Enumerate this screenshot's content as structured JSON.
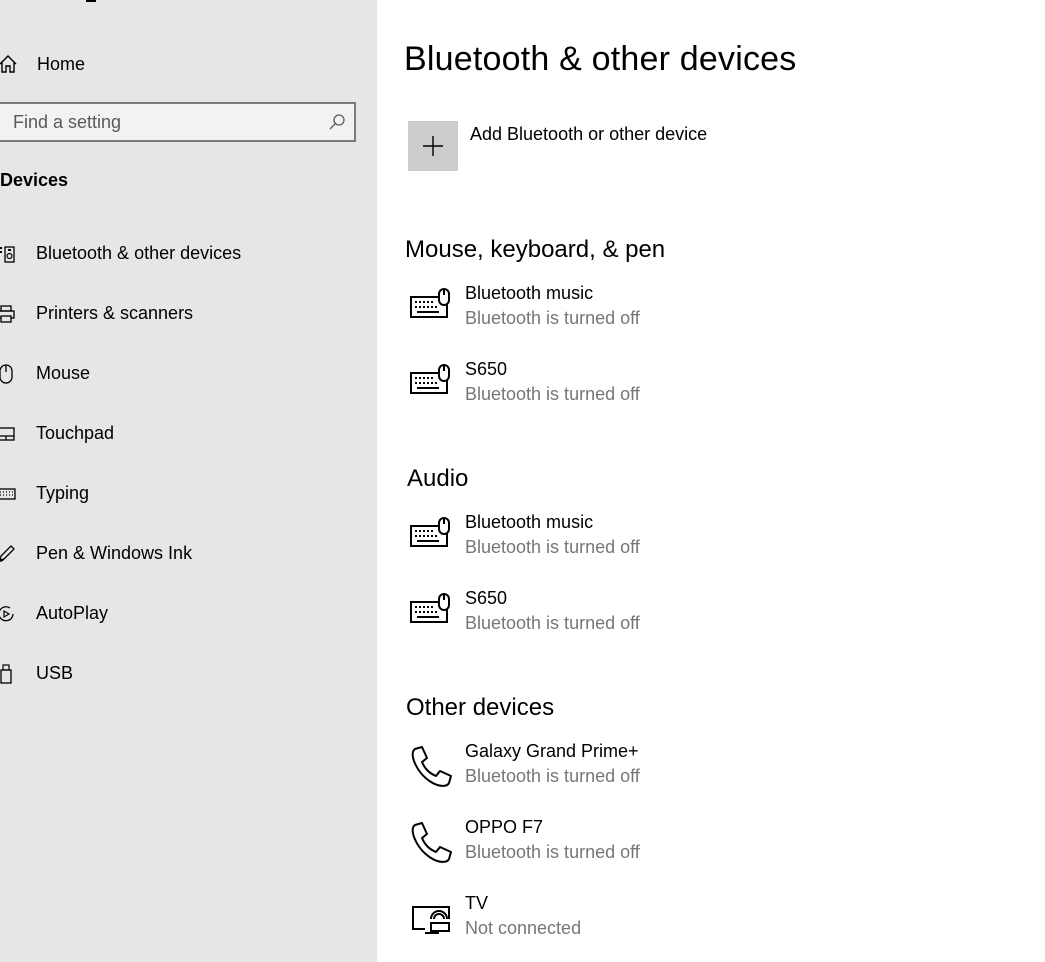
{
  "sidebar": {
    "home_label": "Home",
    "search_placeholder": "Find a setting",
    "section_title": "Devices",
    "items": [
      {
        "label": "Bluetooth & other devices",
        "icon": "bluetooth-devices-icon"
      },
      {
        "label": "Printers & scanners",
        "icon": "printer-icon"
      },
      {
        "label": "Mouse",
        "icon": "mouse-icon"
      },
      {
        "label": "Touchpad",
        "icon": "touchpad-icon"
      },
      {
        "label": "Typing",
        "icon": "keyboard-icon"
      },
      {
        "label": "Pen & Windows Ink",
        "icon": "pen-icon"
      },
      {
        "label": "AutoPlay",
        "icon": "autoplay-icon"
      },
      {
        "label": "USB",
        "icon": "usb-icon"
      }
    ]
  },
  "main": {
    "title": "Bluetooth & other devices",
    "add_label": "Add Bluetooth or other device",
    "groups": [
      {
        "title": "Mouse, keyboard, & pen",
        "devices": [
          {
            "name": "Bluetooth music",
            "status": "Bluetooth is turned off",
            "icon": "keyboard-mouse-icon"
          },
          {
            "name": "S650",
            "status": "Bluetooth is turned off",
            "icon": "keyboard-mouse-icon"
          }
        ]
      },
      {
        "title": "Audio",
        "devices": [
          {
            "name": "Bluetooth music",
            "status": "Bluetooth is turned off",
            "icon": "keyboard-mouse-icon"
          },
          {
            "name": "S650",
            "status": "Bluetooth is turned off",
            "icon": "keyboard-mouse-icon"
          }
        ]
      },
      {
        "title": "Other devices",
        "devices": [
          {
            "name": "Galaxy Grand Prime+",
            "status": "Bluetooth is turned off",
            "icon": "phone-icon"
          },
          {
            "name": "OPPO F7",
            "status": "Bluetooth is turned off",
            "icon": "phone-icon"
          },
          {
            "name": "TV",
            "status": "Not connected",
            "icon": "tv-cast-icon"
          }
        ]
      }
    ]
  },
  "colors": {
    "sidebar_bg": "#e6e6e6",
    "secondary_text": "#767676",
    "add_button_bg": "#cccccc"
  }
}
